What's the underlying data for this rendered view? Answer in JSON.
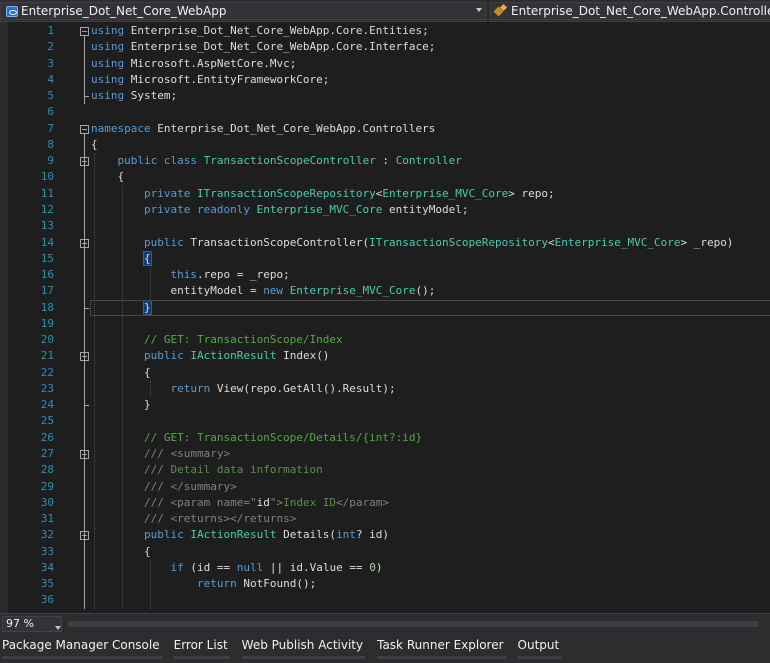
{
  "nav": {
    "project": "Enterprise_Dot_Net_Core_WebApp",
    "class_path": "Enterprise_Dot_Net_Core_WebApp.Controllers.TransactionScopeController"
  },
  "editor": {
    "current_line": 18,
    "lines": [
      {
        "n": "1",
        "t": [
          [
            "kw",
            "using"
          ],
          [
            "",
            " Enterprise_Dot_Net_Core_WebApp.Core.Entities;"
          ]
        ]
      },
      {
        "n": "2",
        "t": [
          [
            "kw",
            "using"
          ],
          [
            "",
            " Enterprise_Dot_Net_Core_WebApp.Core.Interface;"
          ]
        ]
      },
      {
        "n": "3",
        "t": [
          [
            "kw",
            "using"
          ],
          [
            "",
            " Microsoft.AspNetCore.Mvc;"
          ]
        ]
      },
      {
        "n": "4",
        "t": [
          [
            "kw",
            "using"
          ],
          [
            "",
            " Microsoft.EntityFrameworkCore;"
          ]
        ]
      },
      {
        "n": "5",
        "t": [
          [
            "kw",
            "using"
          ],
          [
            "",
            " System;"
          ]
        ]
      },
      {
        "n": "6",
        "t": []
      },
      {
        "n": "7",
        "t": [
          [
            "kw",
            "namespace"
          ],
          [
            "",
            " Enterprise_Dot_Net_Core_WebApp.Controllers"
          ]
        ]
      },
      {
        "n": "8",
        "t": [
          [
            "",
            "{"
          ]
        ]
      },
      {
        "n": "9",
        "t": [
          [
            "",
            "    "
          ],
          [
            "kw",
            "public"
          ],
          [
            "",
            " "
          ],
          [
            "kw",
            "class"
          ],
          [
            "",
            " "
          ],
          [
            "ty",
            "TransactionScopeController"
          ],
          [
            "",
            " : "
          ],
          [
            "ty",
            "Controller"
          ]
        ]
      },
      {
        "n": "10",
        "t": [
          [
            "",
            "    {"
          ]
        ]
      },
      {
        "n": "11",
        "t": [
          [
            "",
            "        "
          ],
          [
            "kw",
            "private"
          ],
          [
            "",
            " "
          ],
          [
            "ty",
            "ITransactionScopeRepository"
          ],
          [
            "",
            "<"
          ],
          [
            "ty",
            "Enterprise_MVC_Core"
          ],
          [
            "",
            "> repo;"
          ]
        ]
      },
      {
        "n": "12",
        "t": [
          [
            "",
            "        "
          ],
          [
            "kw",
            "private"
          ],
          [
            "",
            " "
          ],
          [
            "kw",
            "readonly"
          ],
          [
            "",
            " "
          ],
          [
            "ty",
            "Enterprise_MVC_Core"
          ],
          [
            "",
            " entityModel;"
          ]
        ]
      },
      {
        "n": "13",
        "t": []
      },
      {
        "n": "14",
        "t": [
          [
            "",
            "        "
          ],
          [
            "kw",
            "public"
          ],
          [
            "",
            " TransactionScopeController("
          ],
          [
            "ty",
            "ITransactionScopeRepository"
          ],
          [
            "",
            "<"
          ],
          [
            "ty",
            "Enterprise_MVC_Core"
          ],
          [
            "",
            "> _repo)"
          ]
        ]
      },
      {
        "n": "15",
        "t": [
          [
            "",
            "        "
          ],
          [
            "bh",
            "{"
          ]
        ]
      },
      {
        "n": "16",
        "t": [
          [
            "",
            "            "
          ],
          [
            "kw",
            "this"
          ],
          [
            "",
            ".repo = _repo;"
          ]
        ]
      },
      {
        "n": "17",
        "t": [
          [
            "",
            "            entityModel = "
          ],
          [
            "kw",
            "new"
          ],
          [
            "",
            " "
          ],
          [
            "ty",
            "Enterprise_MVC_Core"
          ],
          [
            "",
            "();"
          ]
        ]
      },
      {
        "n": "18",
        "t": [
          [
            "",
            "        "
          ],
          [
            "bh",
            "}"
          ]
        ]
      },
      {
        "n": "19",
        "t": []
      },
      {
        "n": "20",
        "t": [
          [
            "",
            "        "
          ],
          [
            "cm",
            "// GET: TransactionScope/Index"
          ]
        ]
      },
      {
        "n": "21",
        "t": [
          [
            "",
            "        "
          ],
          [
            "kw",
            "public"
          ],
          [
            "",
            " "
          ],
          [
            "ty",
            "IActionResult"
          ],
          [
            "",
            " Index()"
          ]
        ]
      },
      {
        "n": "22",
        "t": [
          [
            "",
            "        {"
          ]
        ]
      },
      {
        "n": "23",
        "t": [
          [
            "",
            "            "
          ],
          [
            "kw",
            "return"
          ],
          [
            "",
            " View(repo.GetAll().Result);"
          ]
        ]
      },
      {
        "n": "24",
        "t": [
          [
            "",
            "        }"
          ]
        ]
      },
      {
        "n": "25",
        "t": []
      },
      {
        "n": "26",
        "t": [
          [
            "",
            "        "
          ],
          [
            "cm",
            "// GET: TransactionScope/Details/{int?:id}"
          ]
        ]
      },
      {
        "n": "27",
        "t": [
          [
            "",
            "        "
          ],
          [
            "xd",
            "///"
          ],
          [
            "dc",
            " "
          ],
          [
            "xd",
            "<summary>"
          ]
        ]
      },
      {
        "n": "28",
        "t": [
          [
            "",
            "        "
          ],
          [
            "xd",
            "///"
          ],
          [
            "dc",
            " Detail data information"
          ]
        ]
      },
      {
        "n": "29",
        "t": [
          [
            "",
            "        "
          ],
          [
            "xd",
            "///"
          ],
          [
            "dc",
            " "
          ],
          [
            "xd",
            "</summary>"
          ]
        ]
      },
      {
        "n": "30",
        "t": [
          [
            "",
            "        "
          ],
          [
            "xd",
            "///"
          ],
          [
            "dc",
            " "
          ],
          [
            "xd",
            "<param name=\""
          ],
          [
            "",
            "id"
          ],
          [
            "xd",
            "\">"
          ],
          [
            "dc",
            "Index ID"
          ],
          [
            "xd",
            "</param>"
          ]
        ]
      },
      {
        "n": "31",
        "t": [
          [
            "",
            "        "
          ],
          [
            "xd",
            "///"
          ],
          [
            "dc",
            " "
          ],
          [
            "xd",
            "<returns></returns>"
          ]
        ]
      },
      {
        "n": "32",
        "t": [
          [
            "",
            "        "
          ],
          [
            "kw",
            "public"
          ],
          [
            "",
            " "
          ],
          [
            "ty",
            "IActionResult"
          ],
          [
            "",
            " Details("
          ],
          [
            "kw",
            "int"
          ],
          [
            "",
            "? id)"
          ]
        ]
      },
      {
        "n": "33",
        "t": [
          [
            "",
            "        {"
          ]
        ]
      },
      {
        "n": "34",
        "t": [
          [
            "",
            "            "
          ],
          [
            "kw",
            "if"
          ],
          [
            "",
            " (id == "
          ],
          [
            "kw",
            "null"
          ],
          [
            "",
            " || id.Value == "
          ],
          [
            "nm",
            "0"
          ],
          [
            "",
            ")"
          ]
        ]
      },
      {
        "n": "35",
        "t": [
          [
            "",
            "                "
          ],
          [
            "kw",
            "return"
          ],
          [
            "",
            " NotFound();"
          ]
        ]
      },
      {
        "n": "36",
        "t": []
      }
    ]
  },
  "status": {
    "zoom": "97 %"
  },
  "tool_tabs": [
    "Package Manager Console",
    "Error List",
    "Web Publish Activity",
    "Task Runner Explorer",
    "Output"
  ]
}
